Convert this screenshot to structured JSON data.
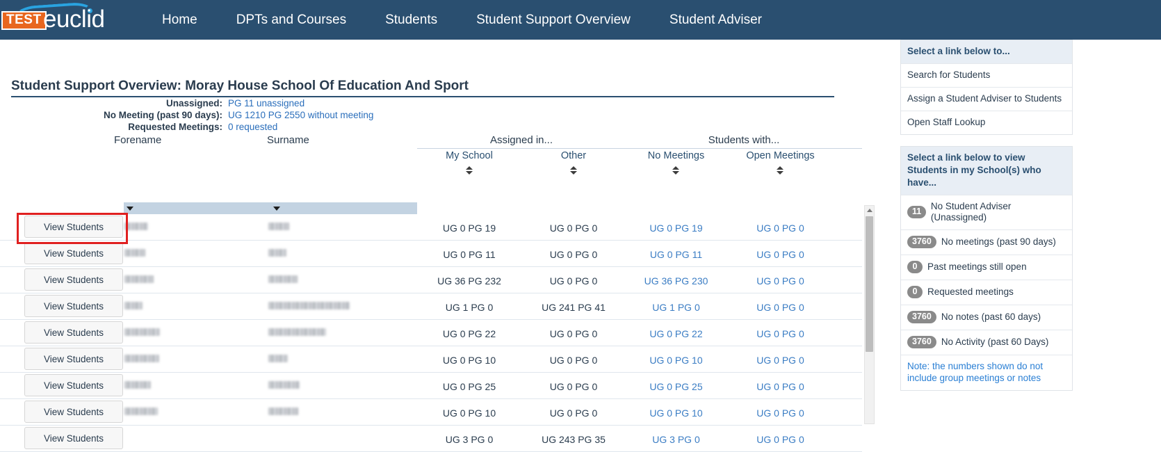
{
  "nav": {
    "logo": {
      "badge": "TEST",
      "wordmark": "euclid"
    },
    "links": [
      {
        "label": "Home"
      },
      {
        "label": "DPTs and Courses"
      },
      {
        "label": "Students"
      },
      {
        "label": "Student Support Overview"
      },
      {
        "label": "Student Adviser"
      }
    ]
  },
  "page": {
    "title": "Student Support Overview: Moray House School Of Education And Sport",
    "summary": [
      {
        "label": "Unassigned:",
        "value": "PG 11 unassigned"
      },
      {
        "label": "No Meeting (past 90 days):",
        "value": "UG 1210 PG 2550 without meeting"
      },
      {
        "label": "Requested Meetings:",
        "value": "0 requested"
      }
    ]
  },
  "table": {
    "group_headers": [
      {
        "label": "Assigned in..."
      },
      {
        "label": "Students with..."
      }
    ],
    "name_headers": [
      {
        "label": "Forename"
      },
      {
        "label": "Surname"
      }
    ],
    "sub_headers": [
      {
        "label": "My School"
      },
      {
        "label": "Other"
      },
      {
        "label": "No Meetings"
      },
      {
        "label": "Open Meetings"
      }
    ],
    "row_button_label": "View Students",
    "rows": [
      {
        "my_school": "UG 0 PG 19",
        "other": "UG 0 PG 0",
        "no_meetings": "UG 0 PG 19",
        "open_meetings": "UG 0 PG 0"
      },
      {
        "my_school": "UG 0 PG 11",
        "other": "UG 0 PG 0",
        "no_meetings": "UG 0 PG 11",
        "open_meetings": "UG 0 PG 0"
      },
      {
        "my_school": "UG 36 PG 232",
        "other": "UG 0 PG 0",
        "no_meetings": "UG 36 PG 230",
        "open_meetings": "UG 0 PG 0"
      },
      {
        "my_school": "UG 1 PG 0",
        "other": "UG 241 PG 41",
        "no_meetings": "UG 1 PG 0",
        "open_meetings": "UG 0 PG 0"
      },
      {
        "my_school": "UG 0 PG 22",
        "other": "UG 0 PG 0",
        "no_meetings": "UG 0 PG 22",
        "open_meetings": "UG 0 PG 0"
      },
      {
        "my_school": "UG 0 PG 10",
        "other": "UG 0 PG 0",
        "no_meetings": "UG 0 PG 10",
        "open_meetings": "UG 0 PG 0"
      },
      {
        "my_school": "UG 0 PG 25",
        "other": "UG 0 PG 0",
        "no_meetings": "UG 0 PG 25",
        "open_meetings": "UG 0 PG 0"
      },
      {
        "my_school": "UG 0 PG 10",
        "other": "UG 0 PG 0",
        "no_meetings": "UG 0 PG 10",
        "open_meetings": "UG 0 PG 0"
      },
      {
        "my_school": "UG 3 PG 0",
        "other": "UG 243 PG 35",
        "no_meetings": "UG 3 PG 0",
        "open_meetings": "UG 0 PG 0"
      }
    ]
  },
  "sidebar": {
    "panel1": {
      "heading": "Select a link below to...",
      "items": [
        {
          "label": "Search for Students"
        },
        {
          "label": "Assign a Student Adviser to Students"
        },
        {
          "label": "Open Staff Lookup"
        }
      ]
    },
    "panel2": {
      "heading": "Select a link below to view Students in my School(s) who have...",
      "items": [
        {
          "count": "11",
          "label": "No Student Adviser (Unassigned)"
        },
        {
          "count": "3760",
          "label": "No meetings (past 90 days)"
        },
        {
          "count": "0",
          "label": "Past meetings still open"
        },
        {
          "count": "0",
          "label": "Requested meetings"
        },
        {
          "count": "3760",
          "label": "No notes (past 60 days)"
        },
        {
          "count": "3760",
          "label": "No Activity (past 60 Days)"
        }
      ],
      "note": "Note: the numbers shown do not include group meetings or notes"
    }
  },
  "colors": {
    "nav_bg": "#2a4f70",
    "accent_blue": "#2a6ebb",
    "link_blue": "#3b7dc4",
    "badge_gray": "#8a8a8a",
    "highlight_red": "#e02020",
    "filter_bar": "#c3d3e2"
  }
}
